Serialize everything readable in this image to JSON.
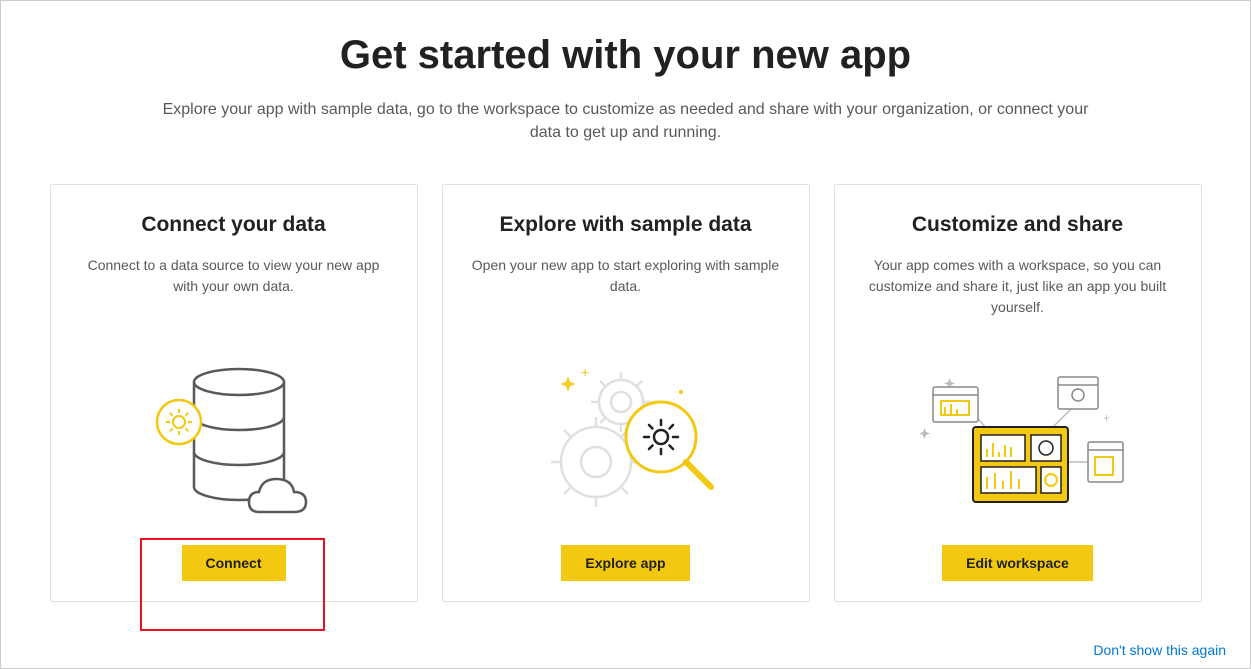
{
  "header": {
    "title": "Get started with your new app",
    "subtitle": "Explore your app with sample data, go to the workspace to customize as needed and share with your organization, or connect your data to get up and running."
  },
  "cards": [
    {
      "title": "Connect your data",
      "description": "Connect to a data source to view your new app with your own data.",
      "button": "Connect"
    },
    {
      "title": "Explore with sample data",
      "description": "Open your new app to start exploring with sample data.",
      "button": "Explore app"
    },
    {
      "title": "Customize and share",
      "description": "Your app comes with a workspace, so you can customize and share it, just like an app you built yourself.",
      "button": "Edit workspace"
    }
  ],
  "footer": {
    "dismiss_link": "Don't show this again"
  }
}
